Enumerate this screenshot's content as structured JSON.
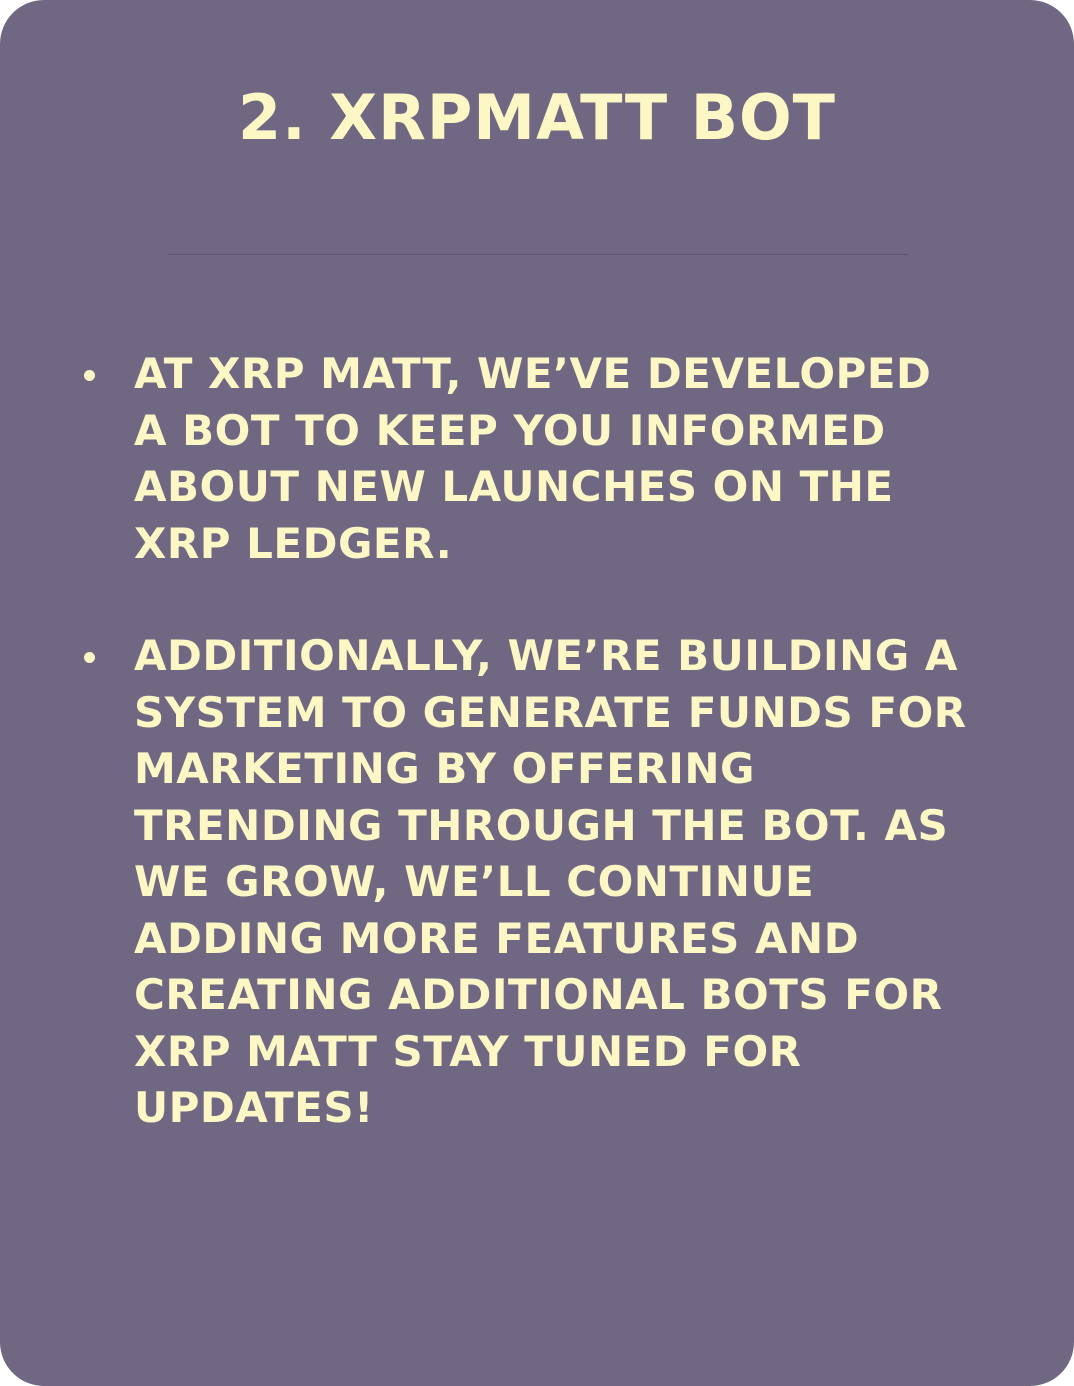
{
  "title": "2. XRPMATT BOT",
  "bullets": [
    {
      "lines": [
        "AT XRP MATT, WE’VE DEVELOPED",
        "A BOT TO KEEP YOU INFORMED",
        "ABOUT NEW LAUNCHES ON THE",
        "XRP LEDGER."
      ]
    },
    {
      "lines": [
        "ADDITIONALLY, WE’RE BUILDING A",
        "SYSTEM TO GENERATE FUNDS FOR",
        "MARKETING BY OFFERING",
        "TRENDING THROUGH THE BOT. AS",
        "WE GROW, WE’LL CONTINUE",
        "ADDING MORE FEATURES AND",
        "CREATING ADDITIONAL BOTS FOR",
        "XRP MATT STAY TUNED FOR",
        "UPDATES!"
      ]
    }
  ],
  "colors": {
    "background": "#706882",
    "text": "#fdf7c6",
    "divider": "#5b546c"
  }
}
